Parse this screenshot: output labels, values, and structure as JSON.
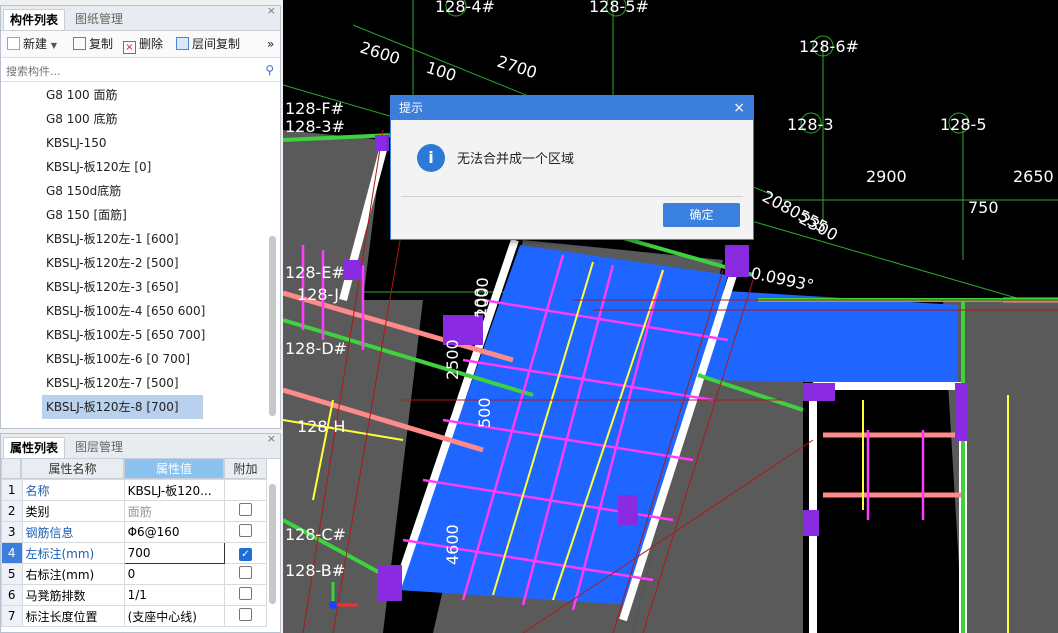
{
  "component_panel": {
    "tabs": [
      "构件列表",
      "图纸管理"
    ],
    "close": "×",
    "toolbar": {
      "new": "新建",
      "copy": "复制",
      "delete": "删除",
      "floor_copy": "层间复制",
      "more": "»"
    },
    "search_placeholder": "搜索构件...",
    "items": [
      "G8 100 面筋",
      "G8 100 底筋",
      "KBSLJ-150",
      "KBSLJ-板120左 [0]",
      "G8 150d底筋",
      "G8 150 [面筋]",
      "KBSLJ-板120左-1 [600]",
      "KBSLJ-板120左-2 [500]",
      "KBSLJ-板120左-3 [650]",
      "KBSLJ-板100左-4 [650 600]",
      "KBSLJ-板100左-5 [650 700]",
      "KBSLJ-板100左-6 [0 700]",
      "KBSLJ-板120左-7 [500]",
      "KBSLJ-板120左-8 [700]"
    ],
    "selected_index": 13
  },
  "property_panel": {
    "tabs": [
      "属性列表",
      "图层管理"
    ],
    "close": "×",
    "headers": [
      "属性名称",
      "属性值",
      "附加"
    ],
    "rows": [
      {
        "num": "1",
        "name": "名称",
        "value": "KBSLJ-板120...",
        "checkbox": ""
      },
      {
        "num": "2",
        "name": "类别",
        "value": "面筋",
        "checkbox": "off"
      },
      {
        "num": "3",
        "name": "钢筋信息",
        "value": "Φ6@160",
        "checkbox": "off"
      },
      {
        "num": "4",
        "name": "左标注(mm)",
        "value": "700",
        "checkbox": "on"
      },
      {
        "num": "5",
        "name": "右标注(mm)",
        "value": "0",
        "checkbox": "off"
      },
      {
        "num": "6",
        "name": "马凳筋排数",
        "value": "1/1",
        "checkbox": "off"
      },
      {
        "num": "7",
        "name": "标注长度位置",
        "value": "(支座中心线)",
        "checkbox": "off"
      }
    ]
  },
  "canvas": {
    "labels": [
      "128-4#",
      "128-5#",
      "128-6#",
      "2600",
      "100",
      "2700",
      "128-F#",
      "128-3#",
      "128-3",
      "128-5",
      "2900",
      "2650",
      "750",
      "128-E#",
      "128-J",
      "128-D#",
      "128-H",
      "128-C#",
      "128-B#",
      "0.0993°",
      "2500",
      "500",
      "4600",
      "100",
      "2000",
      "2080555",
      "2300"
    ]
  },
  "dialog": {
    "title": "提示",
    "close": "×",
    "message": "无法合并成一个区域",
    "ok": "确定"
  },
  "colors": {
    "accent": "#3b7edb",
    "slab_blue": "#1e66ff",
    "magenta": "#ff3cff",
    "yellow": "#ffff3c",
    "green": "#3fd23f"
  }
}
